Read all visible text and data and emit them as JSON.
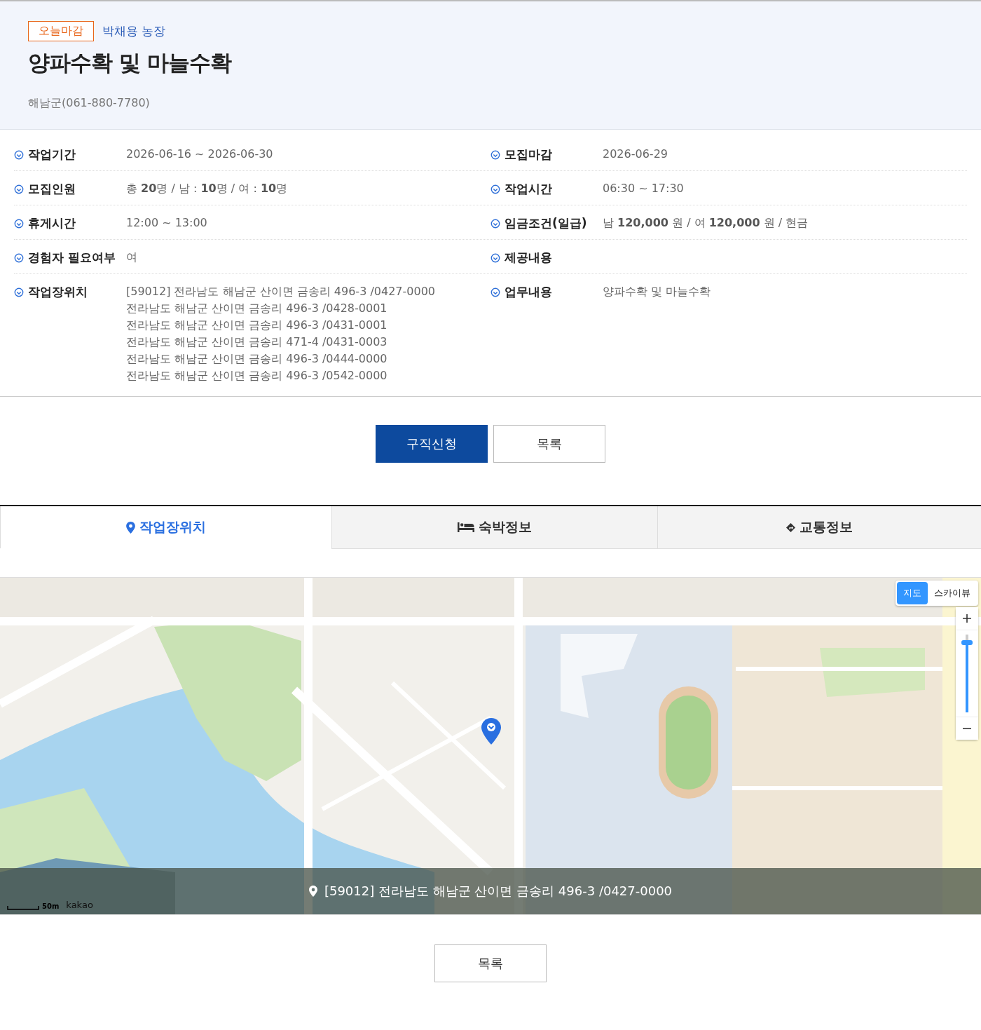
{
  "header": {
    "badge": "오늘마감",
    "company": "박채용 농장",
    "title": "양파수확 및 마늘수확",
    "contact": "해남군(061-880-7780)"
  },
  "details": [
    {
      "left": {
        "label": "작업기간",
        "lines": [
          "2026-06-16 ~ 2026-06-30"
        ]
      },
      "right": {
        "label": "모집마감",
        "lines": [
          "2026-06-29"
        ]
      }
    },
    {
      "left": {
        "label": "모집인원",
        "lines": [
          "총 **20**명 / 남 : **10**명 / 여 : **10**명"
        ]
      },
      "right": {
        "label": "작업시간",
        "lines": [
          "06:30 ~ 17:30"
        ]
      }
    },
    {
      "left": {
        "label": "휴게시간",
        "lines": [
          "12:00 ~ 13:00"
        ]
      },
      "right": {
        "label": "임금조건(일급)",
        "lines": [
          "남 **120,000** 원 / 여 **120,000** 원 / 현금"
        ]
      }
    },
    {
      "left": {
        "label": "경험자 필요여부",
        "lines": [
          "여"
        ]
      },
      "right": {
        "label": "제공내용"
      }
    },
    {
      "left": {
        "label": "작업장위치",
        "lines": [
          "[59012] 전라남도 해남군 산이면 금송리 496-3 /0427-0000",
          "전라남도 해남군 산이면 금송리 496-3 /0428-0001",
          "전라남도 해남군 산이면 금송리 496-3 /0431-0001",
          "전라남도 해남군 산이면 금송리 471-4 /0431-0003",
          "전라남도 해남군 산이면 금송리 496-3 /0444-0000",
          "전라남도 해남군 산이면 금송리 496-3 /0542-0000"
        ]
      },
      "right": {
        "label": "업무내용",
        "lines": [
          "양파수확 및 마늘수확"
        ]
      }
    }
  ],
  "actions": [
    {
      "label": "구직신청",
      "kind": "primary"
    },
    {
      "label": "목록",
      "kind": "secondary"
    }
  ],
  "tabs": [
    {
      "label": "작업장위치",
      "selected": true
    },
    {
      "label": "숙박정보",
      "selected": false
    },
    {
      "label": "교통정보",
      "selected": false
    }
  ],
  "map": {
    "map_types": [
      {
        "label": "지도",
        "selected": true
      },
      {
        "label": "스카이뷰",
        "selected": false
      }
    ],
    "zoom": {
      "level": 0.9
    },
    "scale": "50m",
    "provider": "kakao",
    "address": "[59012] 전라남도 해남군 산이면 금송리 496-3 /0427-0000"
  },
  "footer_button": "목록"
}
